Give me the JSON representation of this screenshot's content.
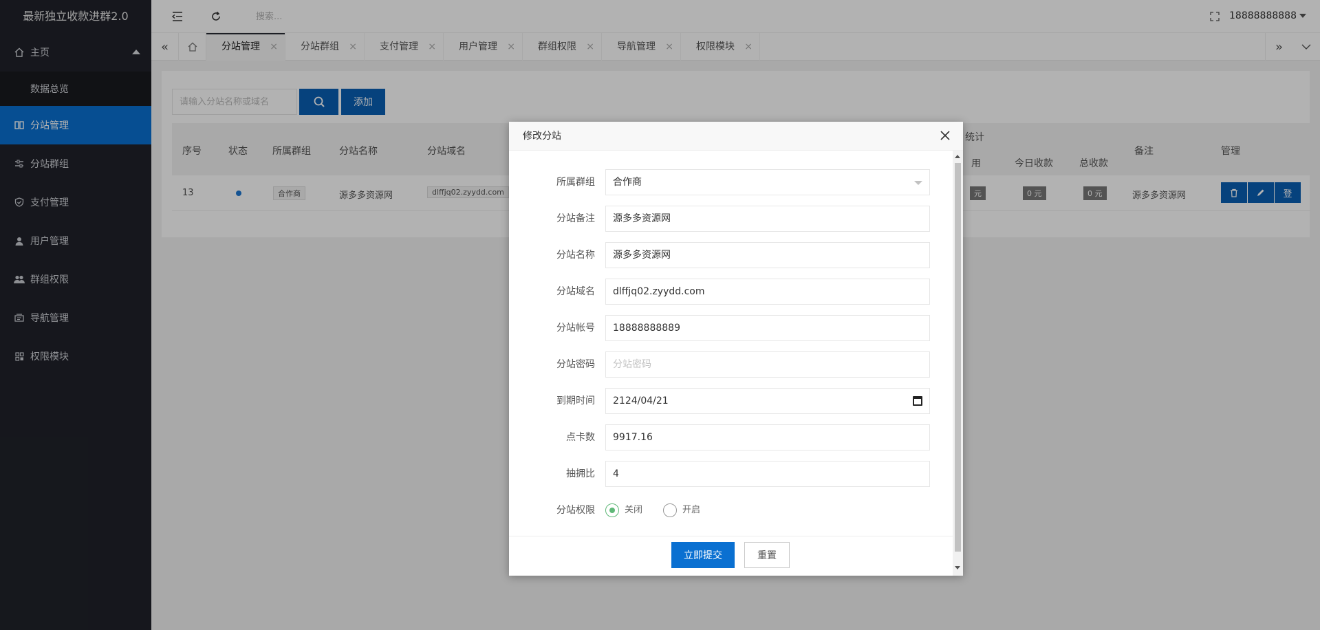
{
  "app": {
    "title": "最新独立收款进群2.0"
  },
  "sidebar": {
    "home": {
      "label": "主页",
      "icon": "home-icon"
    },
    "sub": {
      "label": "数据总览"
    },
    "items": [
      {
        "label": "分站管理",
        "icon": "grid-icon"
      },
      {
        "label": "分站群组",
        "icon": "sliders-icon"
      },
      {
        "label": "支付管理",
        "icon": "shield-icon"
      },
      {
        "label": "用户管理",
        "icon": "user-icon"
      },
      {
        "label": "群组权限",
        "icon": "users-icon"
      },
      {
        "label": "导航管理",
        "icon": "nav-icon"
      },
      {
        "label": "权限模块",
        "icon": "module-icon"
      }
    ]
  },
  "header": {
    "search_placeholder": "搜索...",
    "user": "18888888888"
  },
  "tabs": [
    {
      "label": "分站管理"
    },
    {
      "label": "分站群组"
    },
    {
      "label": "支付管理"
    },
    {
      "label": "用户管理"
    },
    {
      "label": "群组权限"
    },
    {
      "label": "导航管理"
    },
    {
      "label": "权限模块"
    }
  ],
  "toolbar": {
    "search_placeholder": "请输入分站名称或域名",
    "add_label": "添加"
  },
  "table": {
    "headers": [
      "序号",
      "状态",
      "所属群组",
      "分站名称",
      "分站域名",
      "统计",
      "用",
      "今日收款",
      "总收款",
      "备注",
      "管理"
    ],
    "row": {
      "id": "13",
      "group": "合作商",
      "name": "源多多资源网",
      "domain": "dlffjq02.zyydd.com",
      "fee": "元",
      "today": "0 元",
      "total": "0 元",
      "note": "源多多资源网",
      "login_label": "登"
    }
  },
  "modal": {
    "title": "修改分站",
    "fields": {
      "group": {
        "label": "所属群组",
        "value": "合作商"
      },
      "note": {
        "label": "分站备注",
        "value": "源多多资源网"
      },
      "name": {
        "label": "分站名称",
        "value": "源多多资源网"
      },
      "domain": {
        "label": "分站域名",
        "value": "dlffjq02.zyydd.com"
      },
      "account": {
        "label": "分站帐号",
        "value": "18888888889"
      },
      "password": {
        "label": "分站密码",
        "placeholder": "分站密码"
      },
      "expire": {
        "label": "到期时间",
        "value": "2124/04/21"
      },
      "points": {
        "label": "点卡数",
        "value": "9917.16"
      },
      "commission": {
        "label": "抽拥比",
        "value": "4"
      },
      "permission": {
        "label": "分站权限",
        "off": "关闭",
        "on": "开启",
        "selected": "关闭"
      }
    },
    "submit_label": "立即提交",
    "reset_label": "重置"
  }
}
